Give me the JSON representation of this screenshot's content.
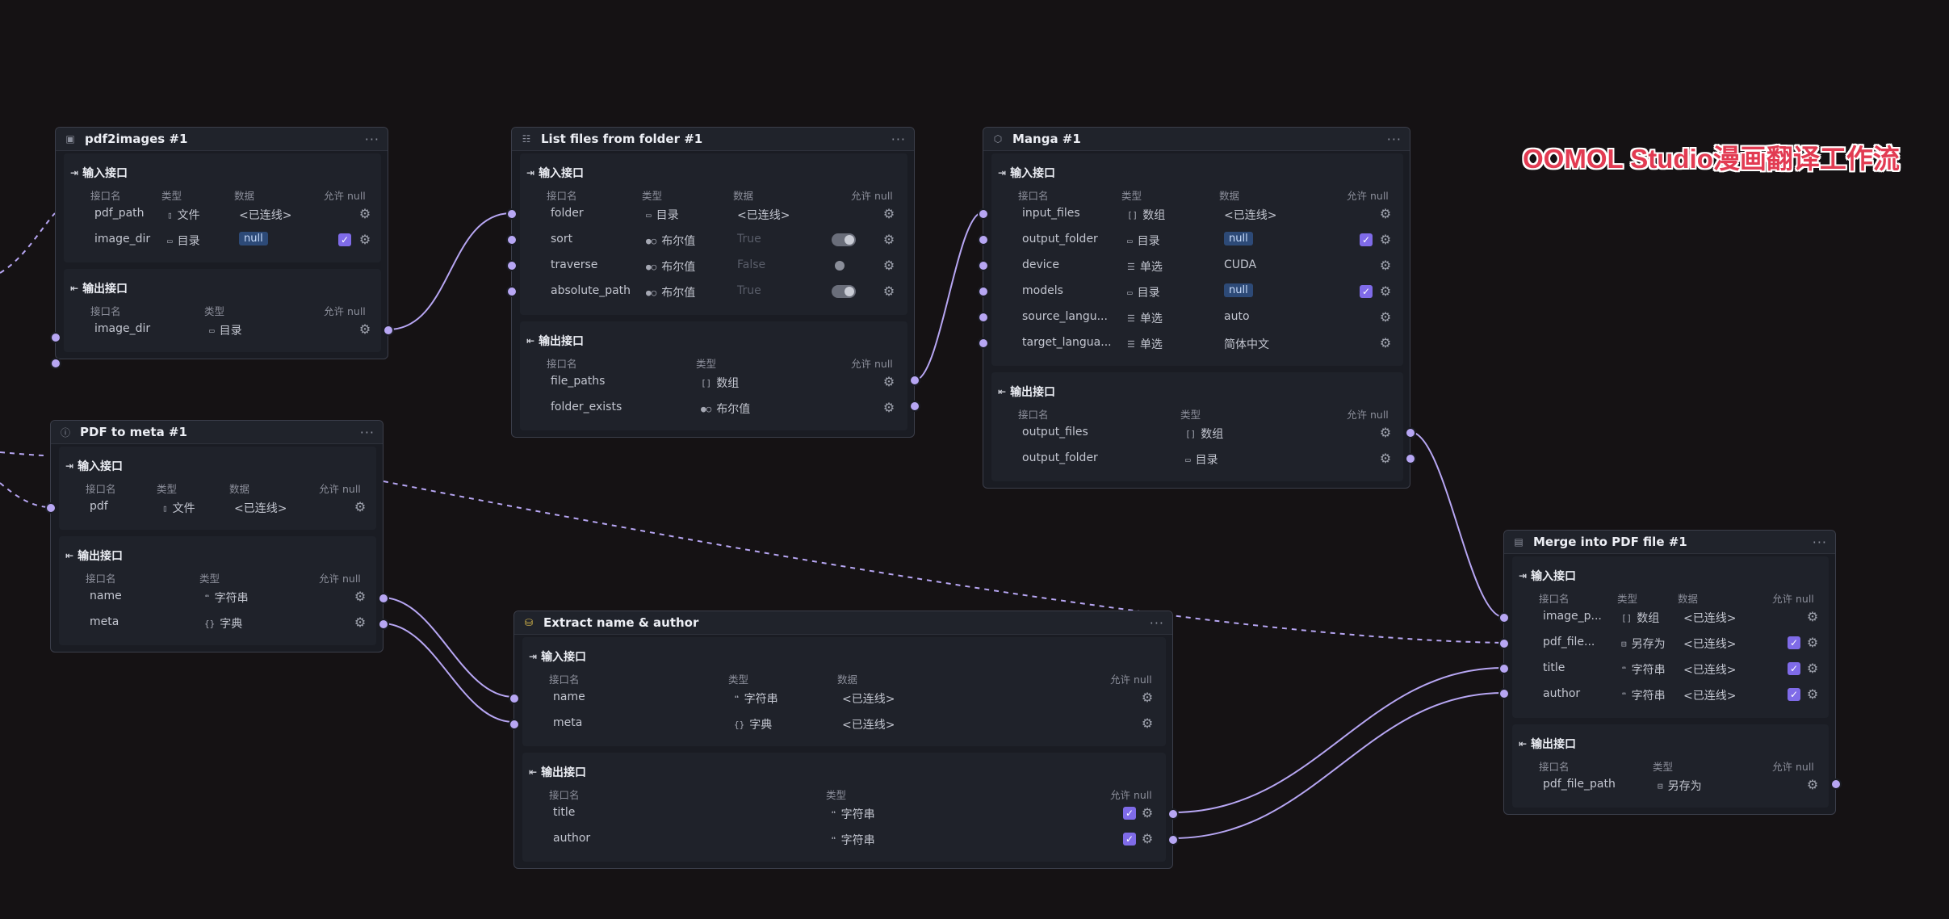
{
  "banner": "OOMOL Studio漫画翻译工作流",
  "labels": {
    "input_section": "输入接口",
    "output_section": "输出接口",
    "col_name": "接口名",
    "col_type": "类型",
    "col_data": "数据",
    "col_null": "允许 null",
    "menu": "···"
  },
  "types": {
    "file": "文件",
    "dir": "目录",
    "bool": "布尔值",
    "array": "数组",
    "select": "单选",
    "string": "字符串",
    "dict": "字典",
    "saveas": "另存为"
  },
  "values": {
    "connected": "<已连线>",
    "null": "null",
    "true": "True",
    "false": "False",
    "cuda": "CUDA",
    "auto": "auto",
    "zh": "简体中文"
  },
  "nodes": {
    "pdf2images": {
      "title": "pdf2images #1",
      "inputs": [
        "pdf_path",
        "image_dir"
      ],
      "outputs": [
        "image_dir"
      ]
    },
    "listfiles": {
      "title": "List files from folder #1",
      "inputs": [
        "folder",
        "sort",
        "traverse",
        "absolute_path"
      ],
      "outputs": [
        "file_paths",
        "folder_exists"
      ]
    },
    "manga": {
      "title": "Manga #1",
      "inputs": [
        "input_files",
        "output_folder",
        "device",
        "models",
        "source_langu...",
        "target_langua..."
      ],
      "outputs": [
        "output_files",
        "output_folder"
      ]
    },
    "pdfmeta": {
      "title": "PDF to meta #1",
      "inputs": [
        "pdf"
      ],
      "outputs": [
        "name",
        "meta"
      ]
    },
    "extract": {
      "title": "Extract name & author",
      "inputs": [
        "name",
        "meta"
      ],
      "outputs": [
        "title",
        "author"
      ]
    },
    "merge": {
      "title": "Merge into PDF file #1",
      "inputs": [
        "image_p...",
        "pdf_file...",
        "title",
        "author"
      ],
      "outputs": [
        "pdf_file_path"
      ]
    }
  },
  "colors": {
    "background": "#151214",
    "node": "#1a1c23",
    "wire": "#b7a6f3",
    "banner": "#e23b52",
    "checkbox": "#7f6be8"
  }
}
